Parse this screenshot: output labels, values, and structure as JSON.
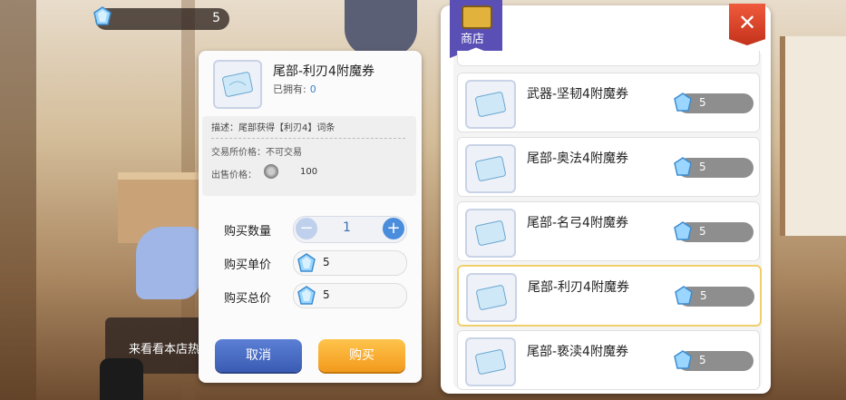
{
  "currency": {
    "icon": "crystal-gem-icon",
    "amount": "5"
  },
  "purchase_panel": {
    "item_name": "尾部-利刃4附魔券",
    "owned_label": "已拥有:",
    "owned_value": "0",
    "description": "描述：尾部获得【利刃4】词条",
    "trade_price": "交易所价格：不可交易",
    "sell_price_label": "出售价格：",
    "sell_price_value": "100",
    "quantity_label": "购买数量",
    "quantity_value": "1",
    "unit_price_label": "购买单价",
    "unit_price_value": "5",
    "total_price_label": "购买总价",
    "total_price_value": "5",
    "cancel_label": "取消",
    "buy_label": "购买"
  },
  "shop": {
    "title": "商店",
    "close_icon": "close-x-icon",
    "items": [
      {
        "name": "武器-坚韧4附魔券",
        "price": "5",
        "selected": false
      },
      {
        "name": "尾部-奥法4附魔券",
        "price": "5",
        "selected": false
      },
      {
        "name": "尾部-名弓4附魔券",
        "price": "5",
        "selected": false
      },
      {
        "name": "尾部-利刃4附魔券",
        "price": "5",
        "selected": true
      },
      {
        "name": "尾部-亵渎4附魔券",
        "price": "5",
        "selected": false
      }
    ]
  },
  "background": {
    "sign_text": "来看看本店热"
  },
  "colors": {
    "accent_blue": "#3a5bb3",
    "accent_orange": "#f29a1c",
    "close_red": "#c3321b",
    "selected_border": "#f0cf6b"
  }
}
